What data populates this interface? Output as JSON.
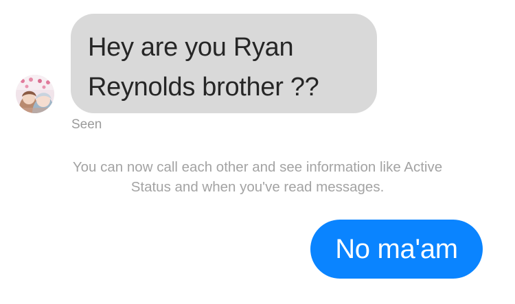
{
  "conversation": {
    "incoming_message": {
      "line1": "Hey are you Ryan",
      "line2": "Reynolds brother ??",
      "bubble_color": "#d9d9d9"
    },
    "seen_label": "Seen",
    "system_notice": {
      "line1": "You can now call each other and see information like Active",
      "line2": "Status and when you've read messages."
    },
    "outgoing_message": {
      "text": "No ma'am",
      "bubble_color": "#0a84ff"
    },
    "avatar": {
      "icon": "profile-photo"
    }
  }
}
